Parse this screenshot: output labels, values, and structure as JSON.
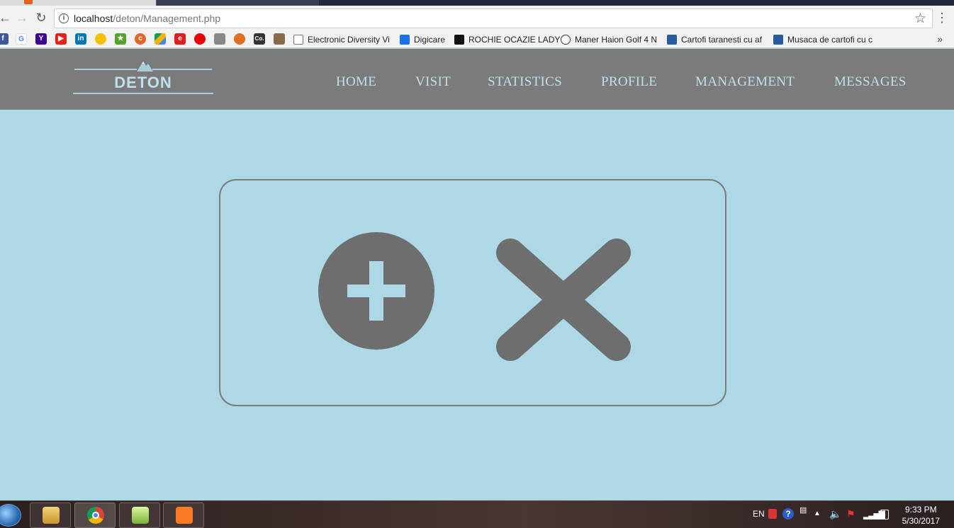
{
  "browser": {
    "url_host": "localhost",
    "url_path": "/deton/Management.php",
    "bookmarks": [
      "Electronic Diversity Vi",
      "Digicare",
      "ROCHIE OCAZIE LADY",
      "Maner Haion Golf 4 N",
      "Cartofi taranesti cu af",
      "Musaca de cartofi cu c"
    ],
    "bookmarks_overflow": "»"
  },
  "site": {
    "logo_text": "DETON",
    "nav": [
      "HOME",
      "VISIT",
      "STATISTICS",
      "PROFILE",
      "MANAGEMENT",
      "MESSAGES"
    ]
  },
  "panel": {
    "add_icon": "plus-circle-icon",
    "delete_icon": "x-icon",
    "icon_color": "#6e6e6e"
  },
  "colors": {
    "page_background": "#add8e6",
    "header_background": "#7b7b7b",
    "nav_text": "#bfe0ec",
    "panel_border": "#7c7c7c"
  },
  "taskbar": {
    "language": "EN",
    "time": "9:33 PM",
    "date": "5/30/2017"
  }
}
